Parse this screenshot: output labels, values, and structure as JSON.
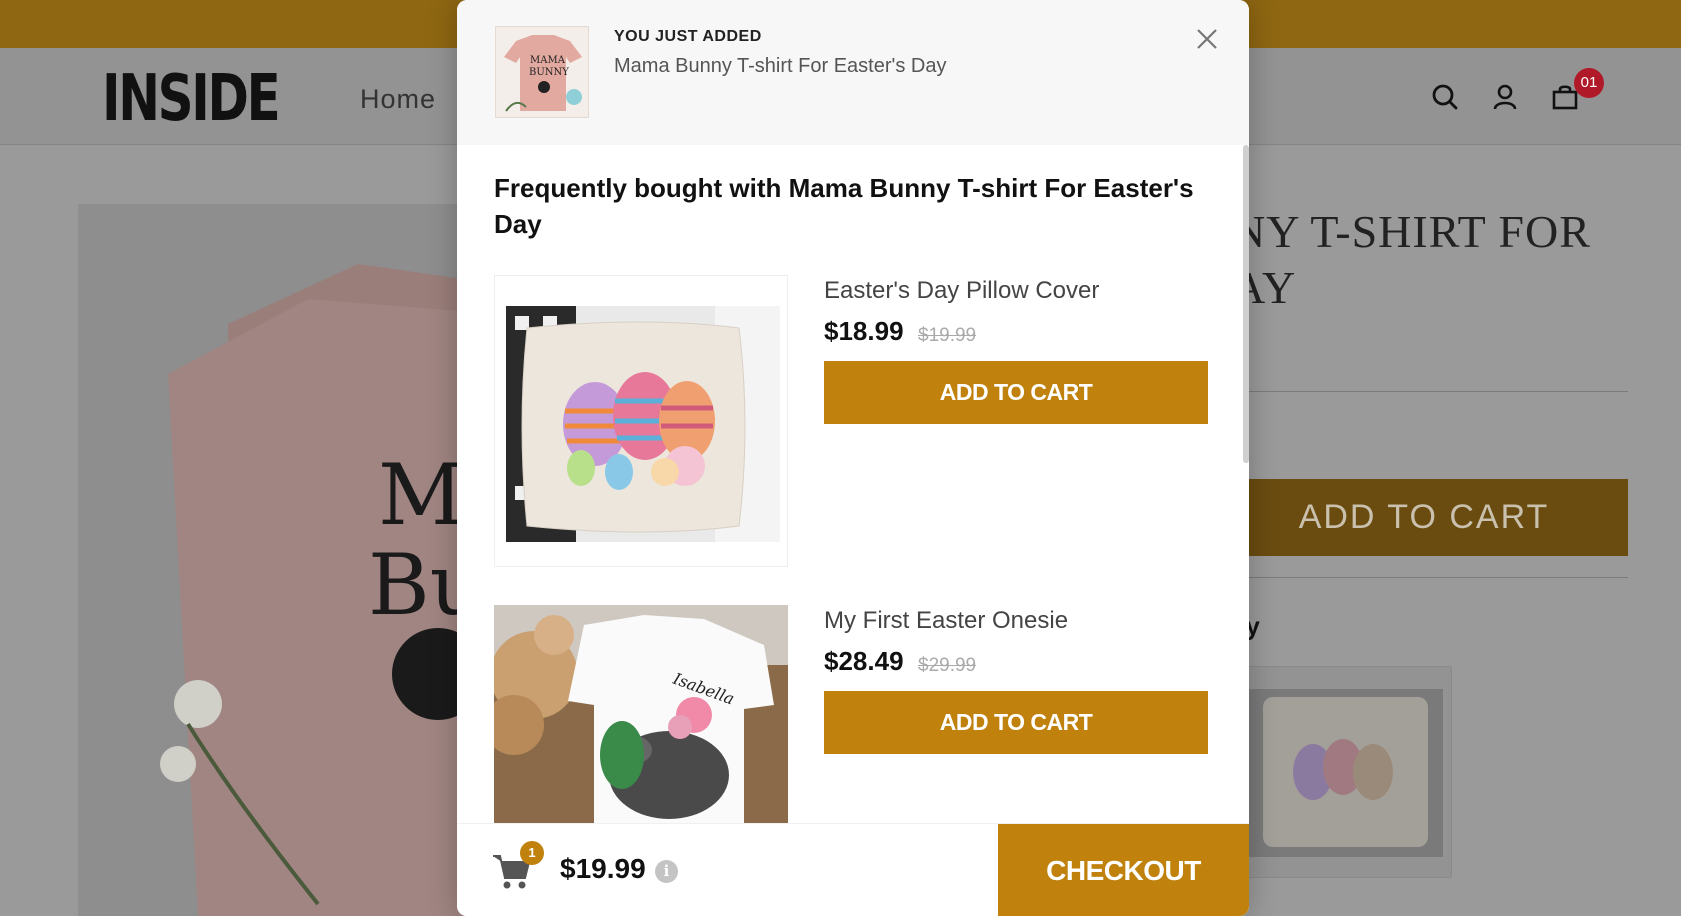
{
  "header": {
    "logo": "INSIDE",
    "nav_home": "Home",
    "cart_count": "01"
  },
  "product": {
    "title_line1": "NY T-SHIRT FOR",
    "title_line2": "AY",
    "add_to_cart": "ADD TO CART",
    "fbt_partial": "ay"
  },
  "modal": {
    "added_label": "YOU JUST ADDED",
    "added_name": "Mama Bunny T-shirt For Easter's Day",
    "fbt_title": "Frequently bought with Mama Bunny T-shirt For Easter's Day",
    "items": [
      {
        "name": "Easter's Day Pillow Cover",
        "price": "$18.99",
        "compare_price": "$19.99",
        "button": "ADD TO CART"
      },
      {
        "name": "My First Easter Onesie",
        "price": "$28.49",
        "compare_price": "$29.99",
        "button": "ADD TO CART"
      }
    ],
    "footer": {
      "badge": "1",
      "total": "$19.99",
      "info": "i",
      "checkout": "CHECKOUT"
    }
  },
  "colors": {
    "accent": "#c0810d",
    "topbar": "#8f6712",
    "badge_red": "#b01a28"
  }
}
